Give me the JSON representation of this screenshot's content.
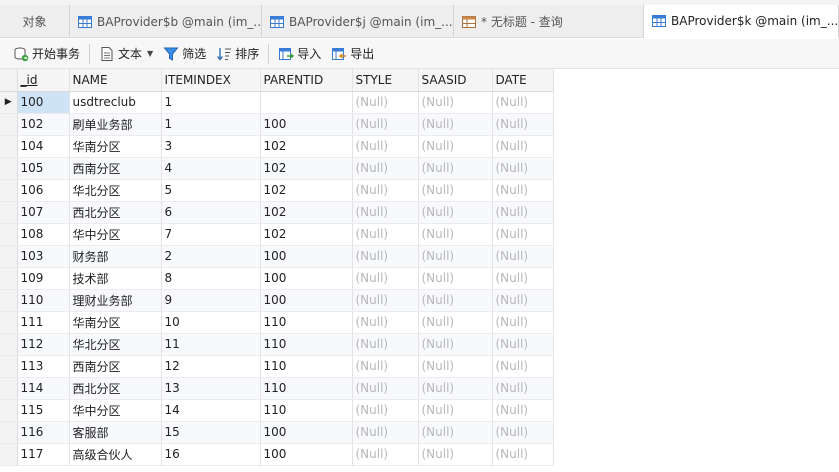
{
  "tabs": [
    {
      "label": "对象",
      "icon": "",
      "active": false
    },
    {
      "label": "BAProvider$b @main (im_...",
      "icon": "table-icon",
      "active": false
    },
    {
      "label": "BAProvider$j @main (im_...",
      "icon": "table-icon",
      "active": false
    },
    {
      "label": "* 无标题 - 查询",
      "icon": "query-icon",
      "active": false
    },
    {
      "label": "BAProvider$k @main (im_...",
      "icon": "table-icon",
      "active": true
    }
  ],
  "toolbar": {
    "begin_transaction": "开始事务",
    "text": "文本",
    "filter": "筛选",
    "sort": "排序",
    "import": "导入",
    "export": "导出"
  },
  "grid": {
    "columns": [
      "_id",
      "NAME",
      "ITEMINDEX",
      "PARENTID",
      "STYLE",
      "SAASID",
      "DATE"
    ],
    "null_text": "(Null)",
    "rows": [
      [
        "100",
        "usdtreclub",
        "1",
        "",
        null,
        null,
        null
      ],
      [
        "102",
        "刷单业务部",
        "1",
        "100",
        null,
        null,
        null
      ],
      [
        "104",
        "华南分区",
        "3",
        "102",
        null,
        null,
        null
      ],
      [
        "105",
        "西南分区",
        "4",
        "102",
        null,
        null,
        null
      ],
      [
        "106",
        "华北分区",
        "5",
        "102",
        null,
        null,
        null
      ],
      [
        "107",
        "西北分区",
        "6",
        "102",
        null,
        null,
        null
      ],
      [
        "108",
        "华中分区",
        "7",
        "102",
        null,
        null,
        null
      ],
      [
        "103",
        "财务部",
        "2",
        "100",
        null,
        null,
        null
      ],
      [
        "109",
        "技术部",
        "8",
        "100",
        null,
        null,
        null
      ],
      [
        "110",
        "理财业务部",
        "9",
        "100",
        null,
        null,
        null
      ],
      [
        "111",
        "华南分区",
        "10",
        "110",
        null,
        null,
        null
      ],
      [
        "112",
        "华北分区",
        "11",
        "110",
        null,
        null,
        null
      ],
      [
        "113",
        "西南分区",
        "12",
        "110",
        null,
        null,
        null
      ],
      [
        "114",
        "西北分区",
        "13",
        "110",
        null,
        null,
        null
      ],
      [
        "115",
        "华中分区",
        "14",
        "110",
        null,
        null,
        null
      ],
      [
        "116",
        "客服部",
        "15",
        "100",
        null,
        null,
        null
      ],
      [
        "117",
        "高级合伙人",
        "16",
        "100",
        null,
        null,
        null
      ]
    ]
  }
}
